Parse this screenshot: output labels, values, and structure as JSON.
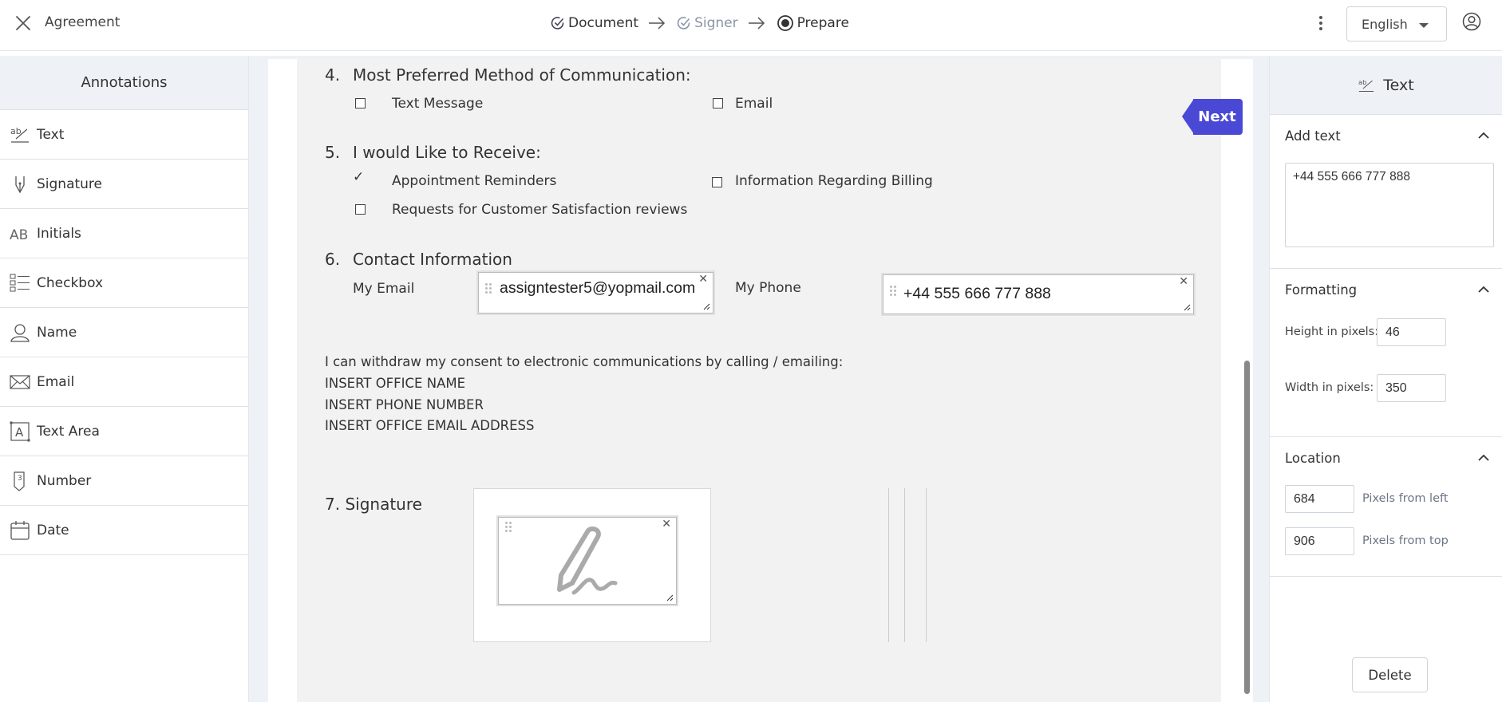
{
  "header": {
    "title": "Agreement",
    "steps": [
      {
        "label": "Document",
        "state": "done"
      },
      {
        "label": "Signer",
        "state": "done"
      },
      {
        "label": "Prepare",
        "state": "current"
      }
    ],
    "language": "English"
  },
  "annotations": {
    "title": "Annotations",
    "items": [
      {
        "label": "Text",
        "icon": "text-tool-icon"
      },
      {
        "label": "Signature",
        "icon": "pen-nib-icon"
      },
      {
        "label": "Initials",
        "icon": "initials-icon"
      },
      {
        "label": "Checkbox",
        "icon": "checklist-icon"
      },
      {
        "label": "Name",
        "icon": "person-icon"
      },
      {
        "label": "Email",
        "icon": "envelope-icon"
      },
      {
        "label": "Text Area",
        "icon": "text-area-icon"
      },
      {
        "label": "Number",
        "icon": "number-icon"
      },
      {
        "label": "Date",
        "icon": "calendar-icon"
      }
    ]
  },
  "document": {
    "q4": {
      "number": "4.",
      "text": "Most Preferred Method of Communication:",
      "options": [
        {
          "label": "Text Message",
          "checked": false
        },
        {
          "label": "Email",
          "checked": false
        }
      ]
    },
    "q5": {
      "number": "5.",
      "text": "I would Like to Receive:",
      "options": [
        {
          "label": "Appointment Reminders",
          "checked": true
        },
        {
          "label": "Information Regarding Billing",
          "checked": false
        },
        {
          "label": "Requests for Customer Satisfaction reviews",
          "checked": false
        }
      ],
      "check_mark": "✓"
    },
    "q6": {
      "number": "6.",
      "text": "Contact Information",
      "email_label": "My Email",
      "email_value": "assigntester5@yopmail.com",
      "phone_label": "My Phone",
      "phone_value": "+44 555 666 777 888"
    },
    "consent": {
      "line1": "I can withdraw my consent to electronic communications by calling / emailing:",
      "line2": "INSERT OFFICE NAME",
      "line3": "INSERT PHONE NUMBER",
      "line4": "INSERT OFFICE EMAIL ADDRESS"
    },
    "q7": {
      "label": "7. Signature"
    },
    "next_label": "Next",
    "close_glyph": "✕"
  },
  "properties": {
    "title": "Text",
    "add_text": {
      "title": "Add text",
      "value": "+44 555 666 777 888"
    },
    "formatting": {
      "title": "Formatting",
      "height_label": "Height in pixels:",
      "height_value": "46",
      "width_label": "Width in pixels:",
      "width_value": "350"
    },
    "location": {
      "title": "Location",
      "left_value": "684",
      "left_label": "Pixels from left",
      "top_value": "906",
      "top_label": "Pixels from top"
    },
    "delete_label": "Delete"
  }
}
